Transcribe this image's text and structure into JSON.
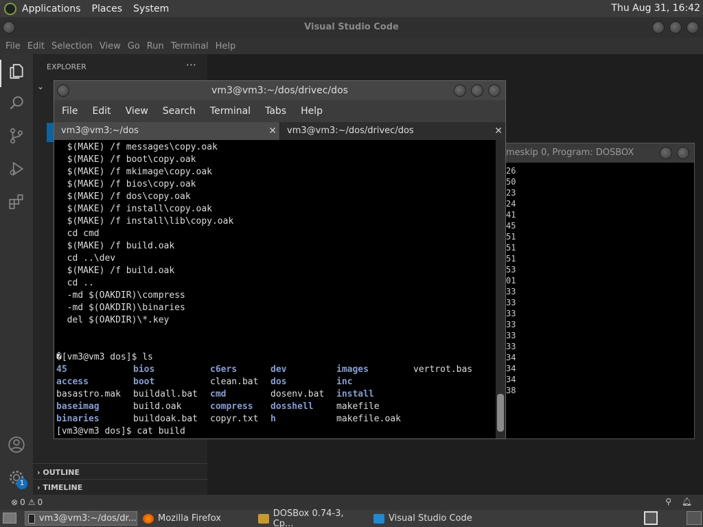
{
  "top_panel": {
    "menus": [
      "Applications",
      "Places",
      "System"
    ],
    "clock": "Thu Aug 31, 16:42"
  },
  "vscode": {
    "title": "Visual Studio Code",
    "menus": [
      "File",
      "Edit",
      "Selection",
      "View",
      "Go",
      "Run",
      "Terminal",
      "Help"
    ],
    "explorer_header": "EXPLORER",
    "explorer_more": "···",
    "outline_label": "OUTLINE",
    "timeline_label": "TIMELINE",
    "settings_badge": "1",
    "status": {
      "errors": "0",
      "warnings": "0"
    }
  },
  "terminal": {
    "title": "vm3@vm3:~/dos/drivec/dos",
    "menus": [
      "File",
      "Edit",
      "View",
      "Search",
      "Terminal",
      "Tabs",
      "Help"
    ],
    "tabs": [
      {
        "label": "vm3@vm3:~/dos"
      },
      {
        "label": "vm3@vm3:~/dos/drivec/dos"
      }
    ],
    "lines": [
      "  $(MAKE) /f messages\\copy.oak",
      "  $(MAKE) /f boot\\copy.oak",
      "  $(MAKE) /f mkimage\\copy.oak",
      "  $(MAKE) /f bios\\copy.oak",
      "  $(MAKE) /f dos\\copy.oak",
      "  $(MAKE) /f install\\copy.oak",
      "  $(MAKE) /f install\\lib\\copy.oak",
      "  cd cmd",
      "  $(MAKE) /f build.oak",
      "  cd ..\\dev",
      "  $(MAKE) /f build.oak",
      "  cd ..",
      "  -md $(OAKDIR)\\compress",
      "  -md $(OAKDIR)\\binaries",
      "  del $(OAKDIR)\\*.key"
    ],
    "prompt_ls": "�[vm3@vm3 dos]$ ls",
    "ls_rows": [
      [
        "45",
        "bios",
        "c6ers",
        "dev",
        "images",
        "vertrot.bas"
      ],
      [
        "access",
        "boot",
        "clean.bat",
        "dos",
        "inc",
        ""
      ],
      [
        "basastro.mak",
        "buildall.bat",
        "cmd",
        "dosenv.bat",
        "install",
        ""
      ],
      [
        "baseimag",
        "build.oak",
        "compress",
        "dosshell",
        "makefile",
        ""
      ],
      [
        "binaries",
        "buildoak.bat",
        "copyr.txt",
        "h",
        "makefile.oak",
        ""
      ]
    ],
    "ls_dirs": [
      [
        true,
        true,
        true,
        true,
        true,
        false
      ],
      [
        true,
        true,
        false,
        true,
        true,
        false
      ],
      [
        false,
        false,
        true,
        false,
        true,
        false
      ],
      [
        true,
        false,
        true,
        true,
        false,
        false
      ],
      [
        true,
        false,
        false,
        true,
        false,
        false
      ]
    ],
    "prompt_last": "[vm3@vm3 dos]$ cat build"
  },
  "dosbox": {
    "title": "meskip  0, Program:  DOSBOX",
    "lines": [
      "26",
      "50",
      "23",
      "24",
      "41",
      "45",
      "51",
      "51",
      "51",
      "53",
      "01",
      "33",
      "33",
      "33",
      "33",
      "33",
      "33",
      "34",
      "34",
      "34",
      "38"
    ]
  },
  "taskbar": {
    "tasks": [
      {
        "label": "vm3@vm3:~/dos/dr..."
      },
      {
        "label": "Mozilla Firefox"
      },
      {
        "label": "DOSBox 0.74-3, Cp..."
      },
      {
        "label": "Visual Studio Code"
      }
    ]
  }
}
